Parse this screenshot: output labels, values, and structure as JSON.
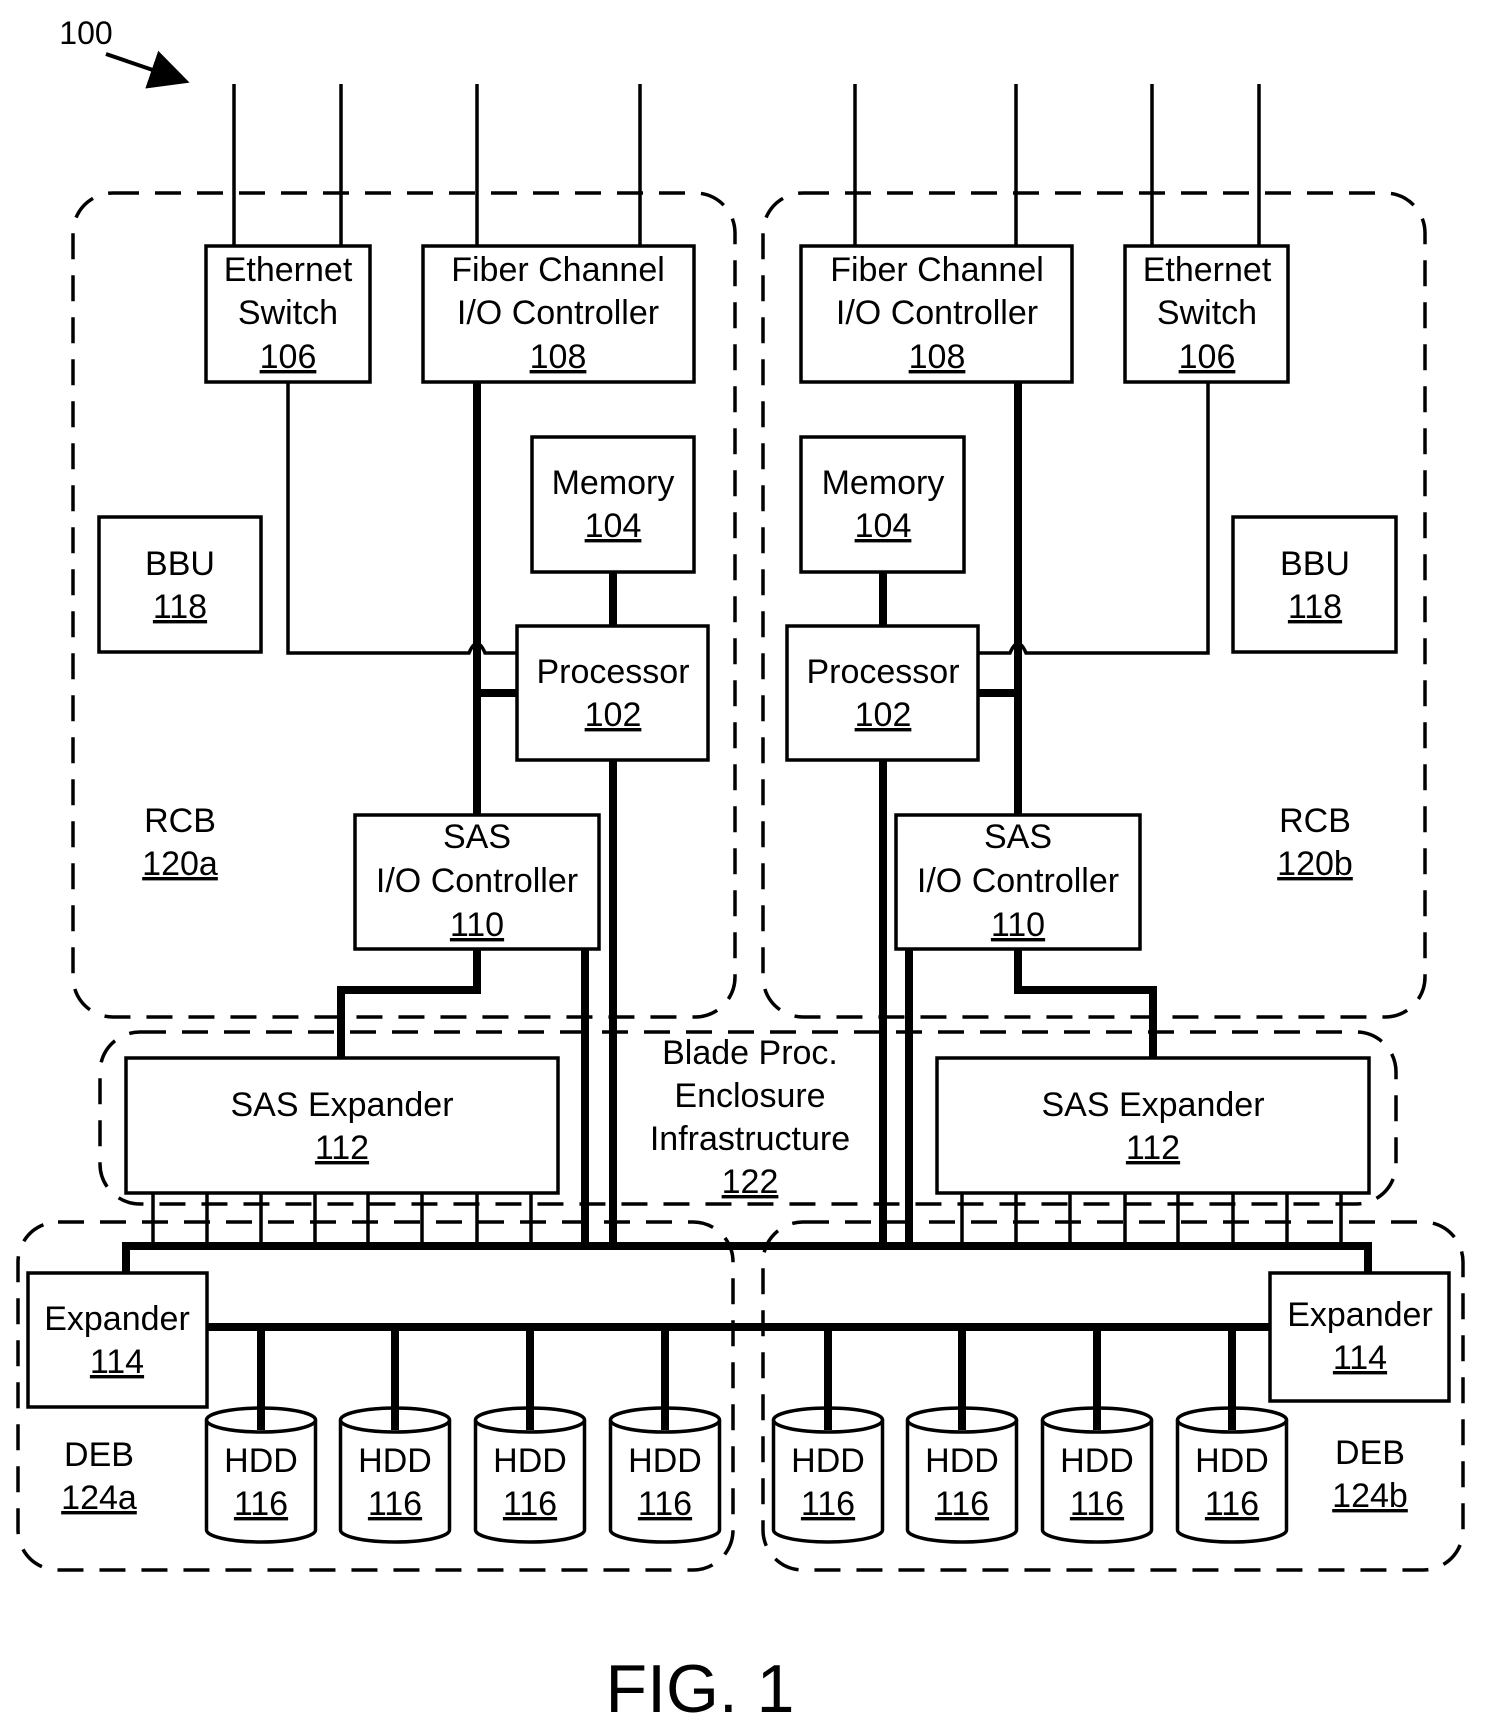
{
  "figure": {
    "ref_number": "100",
    "caption": "FIG. 1"
  },
  "rcb": [
    {
      "label": "RCB",
      "num": "120a"
    },
    {
      "label": "RCB",
      "num": "120b"
    }
  ],
  "deb": [
    {
      "label": "DEB",
      "num": "124a"
    },
    {
      "label": "DEB",
      "num": "124b"
    }
  ],
  "enclosure": {
    "line1": "Blade Proc.",
    "line2": "Enclosure",
    "line3": "Infrastructure",
    "num": "122"
  },
  "components": {
    "ethernet_switch": {
      "line1": "Ethernet",
      "line2": "Switch",
      "num": "106"
    },
    "fc_controller": {
      "line1": "Fiber Channel",
      "line2": "I/O Controller",
      "num": "108"
    },
    "memory": {
      "line1": "Memory",
      "num": "104"
    },
    "bbu": {
      "line1": "BBU",
      "num": "118"
    },
    "processor": {
      "line1": "Processor",
      "num": "102"
    },
    "sas_io": {
      "line1": "SAS",
      "line2": "I/O Controller",
      "num": "110"
    },
    "sas_expander": {
      "line1": "SAS Expander",
      "num": "112"
    },
    "expander": {
      "line1": "Expander",
      "num": "114"
    },
    "hdd": {
      "line1": "HDD",
      "num": "116"
    }
  },
  "hdd_count_per_deb": 4
}
